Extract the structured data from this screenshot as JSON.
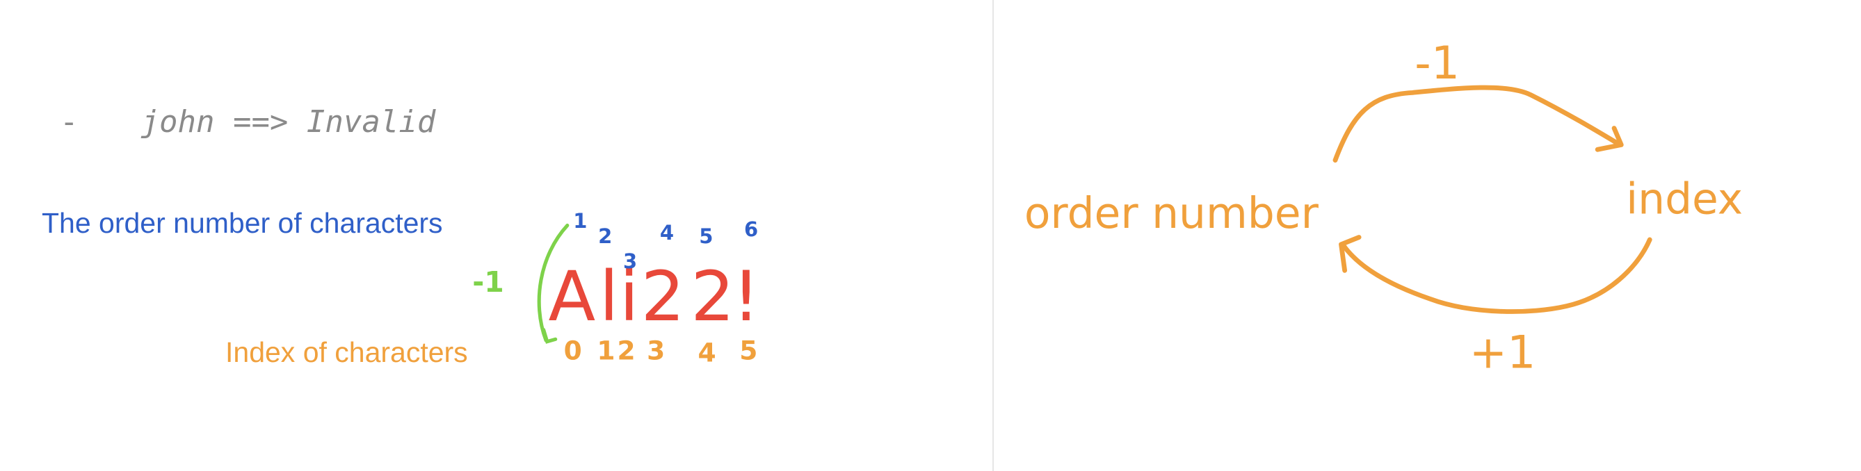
{
  "code_line": {
    "bullet": "-",
    "text": "john ==> Invalid"
  },
  "labels": {
    "order_number": "The order number of characters",
    "index": "Index of characters"
  },
  "example": {
    "word": [
      "A",
      "l",
      "i",
      "2",
      "2",
      "!"
    ],
    "order_numbers": [
      "1",
      "2",
      "3",
      "4",
      "5",
      "6"
    ],
    "indexes": [
      "0",
      "1",
      "2",
      "3",
      "4",
      "5"
    ],
    "offset": "-1"
  },
  "conversion": {
    "left": "order number",
    "right": "index",
    "top_op": "-1",
    "bottom_op": "+1"
  },
  "colors": {
    "blue": "#2f5fc8",
    "orange": "#f0a03c",
    "red": "#e8483a",
    "green": "#7ed24a",
    "gray": "#8a8a8a"
  }
}
